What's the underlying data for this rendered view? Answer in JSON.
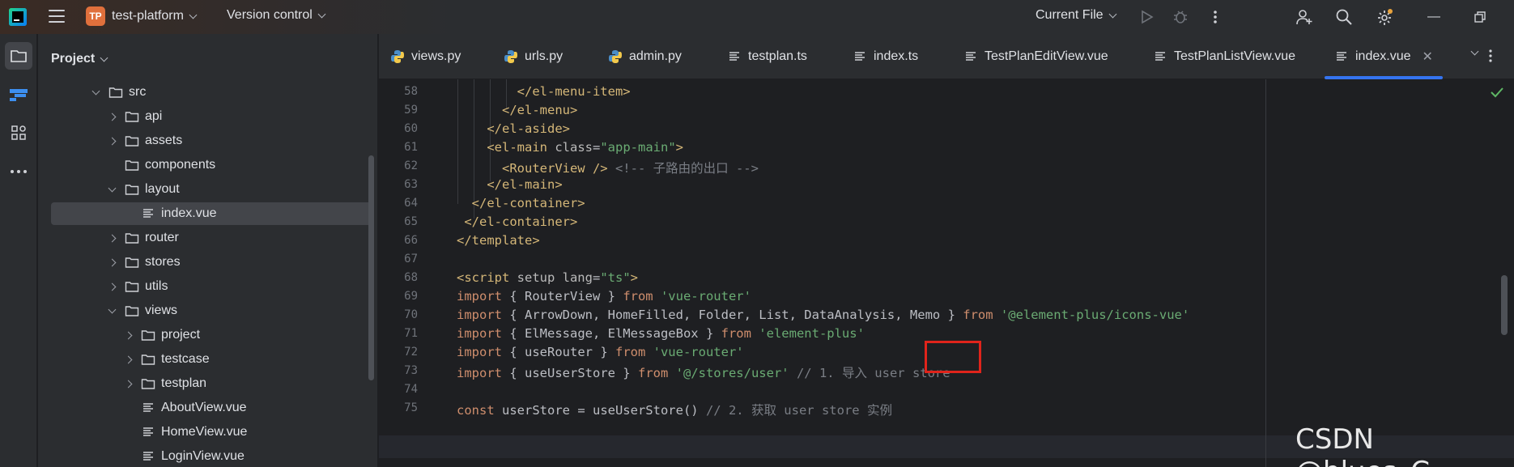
{
  "titlebar": {
    "project_badge": "TP",
    "project_name": "test-platform",
    "vcs_label": "Version control",
    "run_config": "Current File"
  },
  "project_panel": {
    "title": "Project",
    "tree": [
      {
        "label": "src",
        "type": "folder",
        "expanded": true,
        "depth": 0
      },
      {
        "label": "api",
        "type": "folder",
        "expanded": false,
        "depth": 1
      },
      {
        "label": "assets",
        "type": "folder",
        "expanded": false,
        "depth": 1
      },
      {
        "label": "components",
        "type": "folder",
        "expanded": null,
        "depth": 1
      },
      {
        "label": "layout",
        "type": "folder",
        "expanded": true,
        "depth": 1
      },
      {
        "label": "index.vue",
        "type": "file",
        "depth": 2,
        "selected": true
      },
      {
        "label": "router",
        "type": "folder",
        "expanded": false,
        "depth": 1
      },
      {
        "label": "stores",
        "type": "folder",
        "expanded": false,
        "depth": 1
      },
      {
        "label": "utils",
        "type": "folder",
        "expanded": false,
        "depth": 1
      },
      {
        "label": "views",
        "type": "folder",
        "expanded": true,
        "depth": 1
      },
      {
        "label": "project",
        "type": "folder",
        "expanded": false,
        "depth": 2
      },
      {
        "label": "testcase",
        "type": "folder",
        "expanded": false,
        "depth": 2
      },
      {
        "label": "testplan",
        "type": "folder",
        "expanded": false,
        "depth": 2
      },
      {
        "label": "AboutView.vue",
        "type": "file",
        "depth": 2
      },
      {
        "label": "HomeView.vue",
        "type": "file",
        "depth": 2
      },
      {
        "label": "LoginView.vue",
        "type": "file",
        "depth": 2
      }
    ]
  },
  "tabs": [
    {
      "label": "views.py",
      "icon": "python-icon"
    },
    {
      "label": "urls.py",
      "icon": "python-icon"
    },
    {
      "label": "admin.py",
      "icon": "python-icon"
    },
    {
      "label": "testplan.ts",
      "icon": "text-file-icon"
    },
    {
      "label": "index.ts",
      "icon": "text-file-icon"
    },
    {
      "label": "TestPlanEditView.vue",
      "icon": "text-file-icon"
    },
    {
      "label": "TestPlanListView.vue",
      "icon": "text-file-icon"
    },
    {
      "label": "index.vue",
      "icon": "text-file-icon",
      "active": true
    }
  ],
  "editor": {
    "lines": [
      {
        "n": "58",
        "code": [
          {
            "t": "        </el-menu-item>",
            "c": "tag"
          }
        ]
      },
      {
        "n": "59",
        "code": [
          {
            "t": "      </el-menu>",
            "c": "tag"
          }
        ]
      },
      {
        "n": "60",
        "code": [
          {
            "t": "    </el-aside>",
            "c": "tag"
          }
        ]
      },
      {
        "n": "61",
        "code": [
          {
            "t": "    <el-main ",
            "c": "tag"
          },
          {
            "t": "class",
            "c": "attr"
          },
          {
            "t": "=",
            "c": ""
          },
          {
            "t": "\"app-main\"",
            "c": "str"
          },
          {
            "t": ">",
            "c": "tag"
          }
        ]
      },
      {
        "n": "62",
        "code": [
          {
            "t": "      <RouterView />",
            "c": "tag"
          },
          {
            "t": " <!-- 子路由的出口 -->",
            "c": "cmt"
          }
        ]
      },
      {
        "n": "63",
        "code": [
          {
            "t": "    </el-main>",
            "c": "tag"
          }
        ]
      },
      {
        "n": "64",
        "code": [
          {
            "t": "  </el-container>",
            "c": "tag"
          }
        ]
      },
      {
        "n": "65",
        "code": [
          {
            "t": " </el-container>",
            "c": "tag"
          }
        ]
      },
      {
        "n": "66",
        "code": [
          {
            "t": "</template>",
            "c": "tag"
          }
        ]
      },
      {
        "n": "67",
        "code": []
      },
      {
        "n": "68",
        "code": [
          {
            "t": "<script ",
            "c": "tag"
          },
          {
            "t": "setup lang",
            "c": "attr"
          },
          {
            "t": "=",
            "c": ""
          },
          {
            "t": "\"ts\"",
            "c": "str"
          },
          {
            "t": ">",
            "c": "tag"
          }
        ]
      },
      {
        "n": "69",
        "code": [
          {
            "t": "import",
            "c": "kw"
          },
          {
            "t": " { RouterView } ",
            "c": ""
          },
          {
            "t": "from",
            "c": "kw"
          },
          {
            "t": " 'vue-router'",
            "c": "str"
          }
        ]
      },
      {
        "n": "70",
        "code": [
          {
            "t": "import",
            "c": "kw"
          },
          {
            "t": " { ArrowDown, HomeFilled, Folder, List, DataAnalysis, Memo } ",
            "c": ""
          },
          {
            "t": "from",
            "c": "kw"
          },
          {
            "t": " '@element-plus/icons-vue'",
            "c": "str"
          }
        ]
      },
      {
        "n": "71",
        "code": [
          {
            "t": "import",
            "c": "kw"
          },
          {
            "t": " { ElMessage, ElMessageBox } ",
            "c": ""
          },
          {
            "t": "from",
            "c": "kw"
          },
          {
            "t": " 'element-plus'",
            "c": "str"
          }
        ]
      },
      {
        "n": "72",
        "code": [
          {
            "t": "import",
            "c": "kw"
          },
          {
            "t": " { useRouter } ",
            "c": ""
          },
          {
            "t": "from",
            "c": "kw"
          },
          {
            "t": " 'vue-router'",
            "c": "str"
          }
        ]
      },
      {
        "n": "73",
        "code": [
          {
            "t": "import",
            "c": "kw"
          },
          {
            "t": " { useUserStore } ",
            "c": ""
          },
          {
            "t": "from",
            "c": "kw"
          },
          {
            "t": " '@/stores/user'",
            "c": "str"
          },
          {
            "t": " // 1. 导入 user store",
            "c": "cmt"
          }
        ]
      },
      {
        "n": "74",
        "code": []
      },
      {
        "n": "75",
        "code": [
          {
            "t": "const",
            "c": "kw"
          },
          {
            "t": " userStore = useUserStore() ",
            "c": ""
          },
          {
            "t": "// 2. 获取 user store 实例",
            "c": "cmt"
          }
        ]
      }
    ]
  },
  "watermark": "CSDN @blues_C",
  "colors": {
    "accent": "#3574f0",
    "highlight_box": "#e0241b"
  }
}
